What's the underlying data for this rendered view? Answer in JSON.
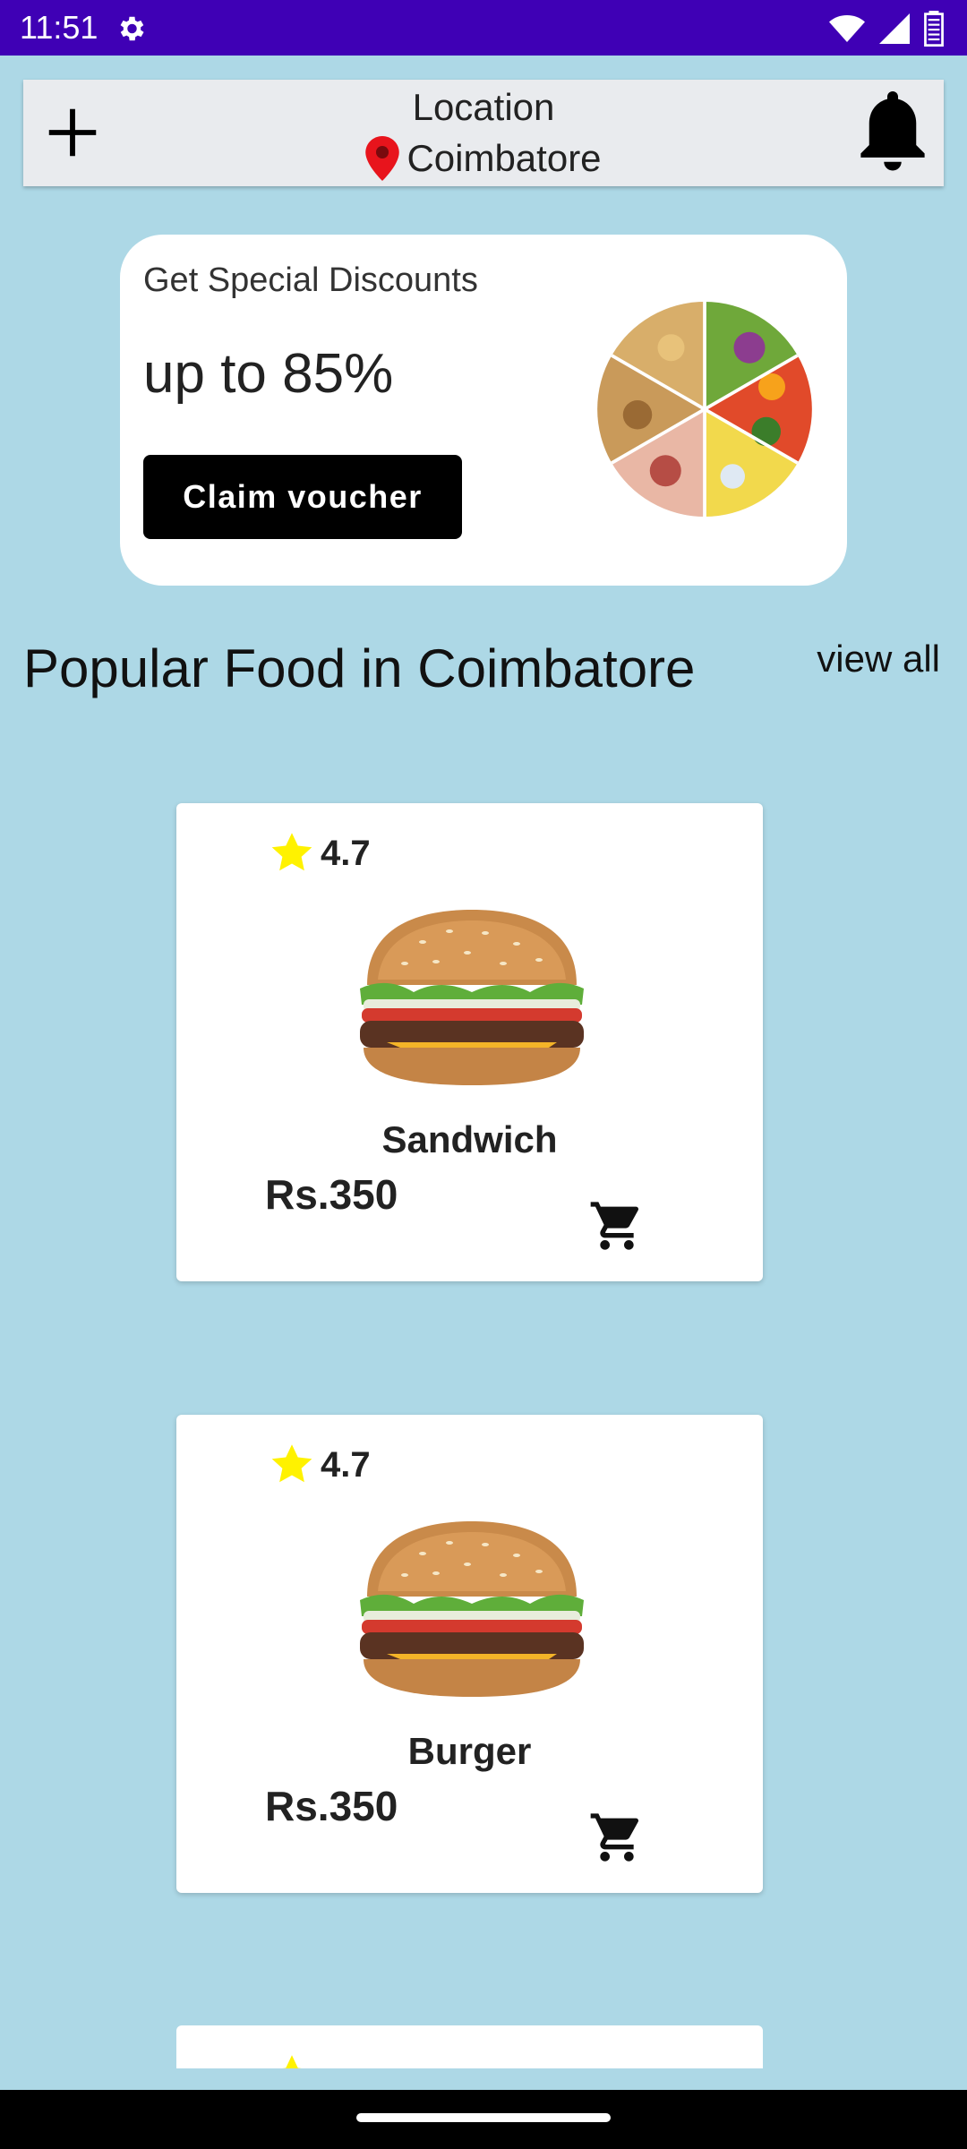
{
  "status_bar": {
    "time": "11:51",
    "icons": [
      "settings-icon",
      "wifi-icon",
      "signal-icon",
      "battery-icon"
    ]
  },
  "toolbar": {
    "add_icon": "add-icon",
    "location_label": "Location",
    "location_name": "Coimbatore",
    "pin_icon": "location-pin-icon",
    "bell_icon": "notification-bell-icon"
  },
  "promo": {
    "title": "Get Special Discounts",
    "value": "up to 85%",
    "button_label": "Claim voucher",
    "image_icon": "food-wheel-image"
  },
  "section": {
    "title": "Popular Food in Coimbatore",
    "view_all": "view all"
  },
  "foods": [
    {
      "name": "Sandwich",
      "rating": "4.7",
      "price": "Rs.350"
    },
    {
      "name": "Burger",
      "rating": "4.7",
      "price": "Rs.350"
    }
  ],
  "colors": {
    "status_bar": "#3f00b5",
    "background": "#add8e6",
    "toolbar": "#e9ebee",
    "pin": "#e8141c",
    "star": "#fff200"
  }
}
